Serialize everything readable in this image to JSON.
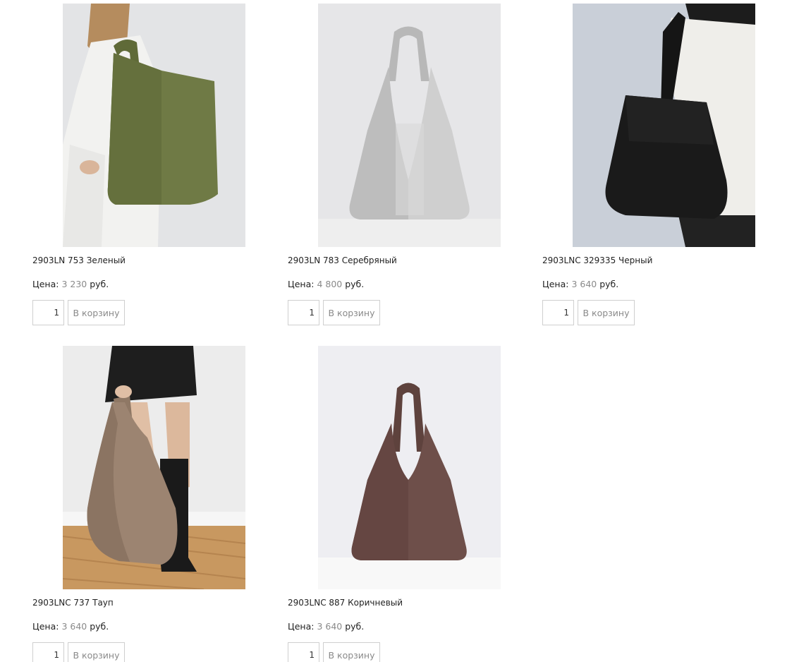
{
  "products": [
    {
      "title": "2903LN 753 Зеленый",
      "price_label": "Цена:",
      "price_value": "3 230",
      "currency": "руб.",
      "quantity": "1",
      "cart_label": "В корзину",
      "bag_color": "#6f7a45",
      "image": "woman-in-white-with-green-leather-shoulder-bag"
    },
    {
      "title": "2903LN 783 Серебряный",
      "price_label": "Цена:",
      "price_value": "4 800",
      "currency": "руб.",
      "quantity": "1",
      "cart_label": "В корзину",
      "bag_color": "#c8c8c8",
      "image": "silver-metallic-hobo-bag"
    },
    {
      "title": "2903LNC 329335 Черный",
      "price_label": "Цена:",
      "price_value": "3 640",
      "currency": "руб.",
      "quantity": "1",
      "cart_label": "В корзину",
      "bag_color": "#1a1a1a",
      "image": "black-suede-shoulder-bag"
    },
    {
      "title": "2903LNC 737 Тауп",
      "price_label": "Цена:",
      "price_value": "3 640",
      "currency": "руб.",
      "quantity": "1",
      "cart_label": "В корзину",
      "bag_color": "#9c8471",
      "image": "taupe-suede-hobo-bag-held-by-woman"
    },
    {
      "title": "2903LNC 887 Коричневый",
      "price_label": "Цена:",
      "price_value": "3 640",
      "currency": "руб.",
      "quantity": "1",
      "cart_label": "В корзину",
      "bag_color": "#6e4f4a",
      "image": "brown-suede-hobo-bag"
    }
  ]
}
